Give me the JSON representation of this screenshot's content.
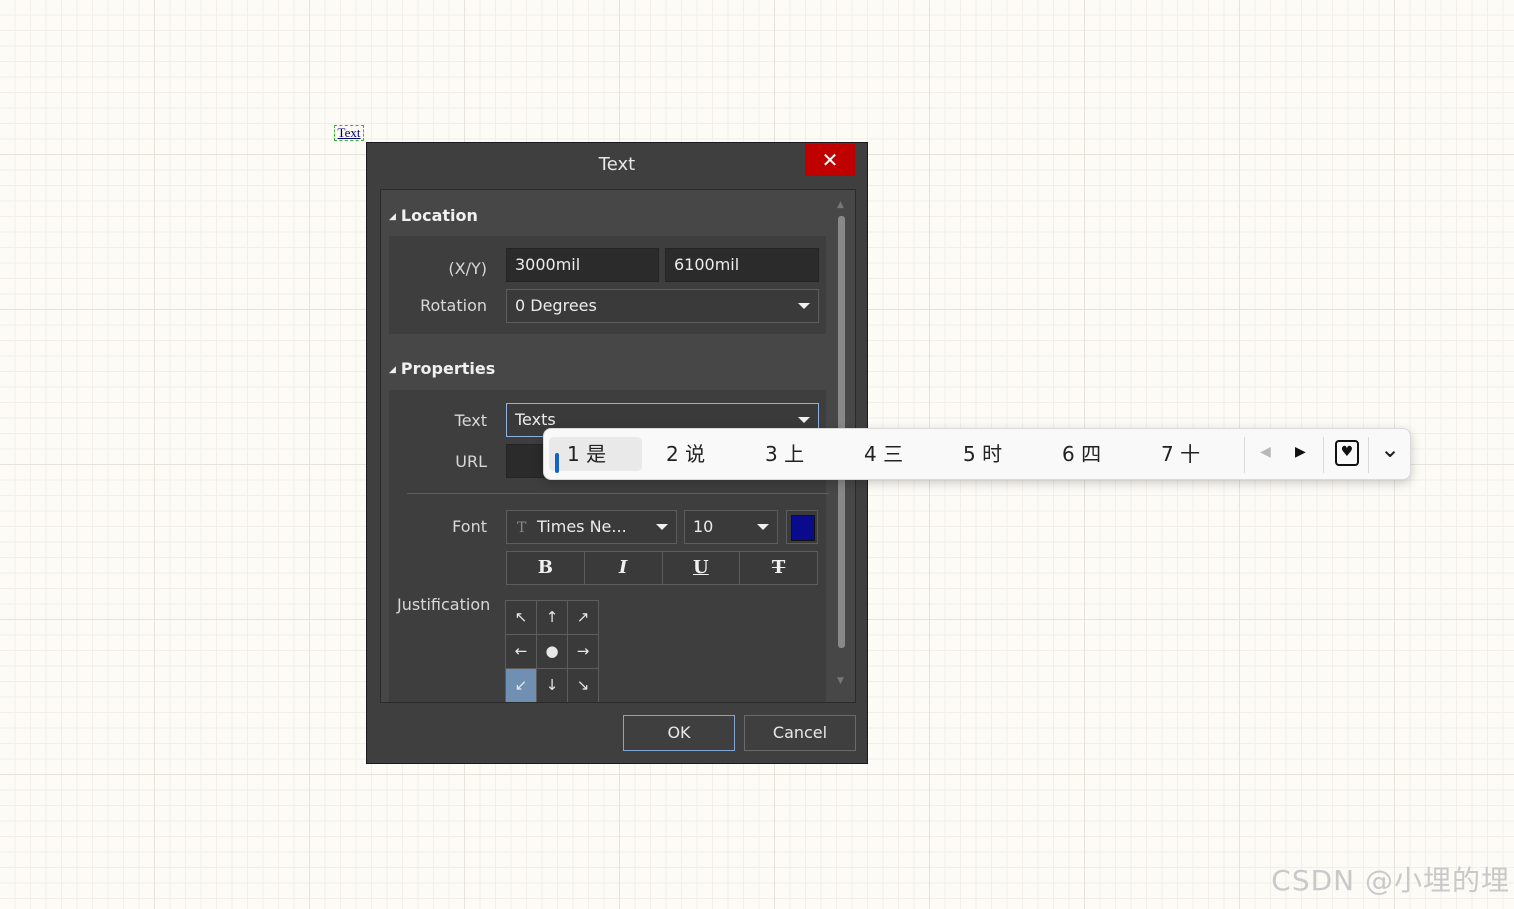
{
  "canvas": {
    "placed_text": "Text",
    "watermark": "CSDN @小埋的埋"
  },
  "dialog": {
    "title": "Text",
    "close_glyph": "✕",
    "location": {
      "heading": "Location",
      "xy_label": "(X/Y)",
      "x_value": "3000mil",
      "y_value": "6100mil",
      "rotation_label": "Rotation",
      "rotation_value": "0 Degrees"
    },
    "properties": {
      "heading": "Properties",
      "text_label": "Text",
      "text_value": "Texts",
      "url_label": "URL",
      "url_value": "",
      "font_label": "Font",
      "font_family": "Times Ne...",
      "font_size": "10",
      "font_color": "#0a0a8c",
      "bold": "B",
      "italic": "I",
      "underline": "U",
      "strikethrough": "T",
      "justification_label": "Justification",
      "justification": [
        "↖",
        "↑",
        "↗",
        "←",
        "●",
        "→",
        "↙",
        "↓",
        "↘"
      ],
      "justification_selected": "bottom-left"
    },
    "ok_label": "OK",
    "cancel_label": "Cancel"
  },
  "ime": {
    "candidates": [
      "1 是",
      "2 说",
      "3 上",
      "4 三",
      "5 时",
      "6 四",
      "7 十"
    ],
    "prev_glyph": "◀",
    "next_glyph": "▶",
    "favorite_glyph": "♥",
    "expand_glyph": "⌄"
  }
}
